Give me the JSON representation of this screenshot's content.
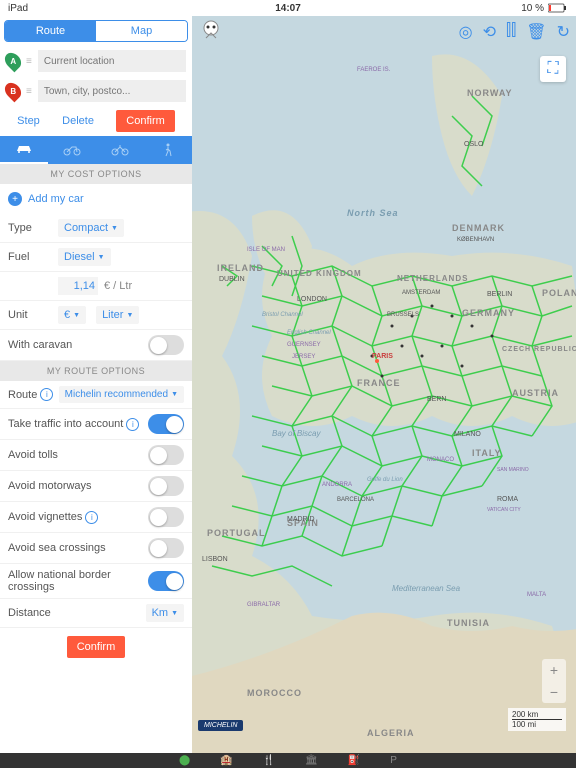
{
  "status": {
    "device": "iPad",
    "time": "14:07",
    "battery": "10 %"
  },
  "tabs": {
    "route": "Route",
    "map": "Map"
  },
  "waypoints": {
    "a": {
      "letter": "A",
      "color": "#2e9e5b",
      "placeholder": "Current location"
    },
    "b": {
      "letter": "B",
      "color": "#d9321f",
      "placeholder": "Town, city, postco..."
    }
  },
  "actions": {
    "step": "Step",
    "delete": "Delete",
    "confirm": "Confirm"
  },
  "sections": {
    "cost": "MY COST OPTIONS",
    "route": "MY ROUTE OPTIONS"
  },
  "addCar": "Add my car",
  "cost": {
    "typeLabel": "Type",
    "typeValue": "Compact",
    "fuelLabel": "Fuel",
    "fuelValue": "Diesel",
    "priceValue": "1,14",
    "priceUnit": "€ / Ltr",
    "unitLabel": "Unit",
    "currency": "€",
    "volume": "Liter",
    "caravanLabel": "With caravan"
  },
  "route": {
    "routeLabel": "Route",
    "routeValue": "Michelin recommended",
    "traffic": "Take traffic into account",
    "tolls": "Avoid tolls",
    "motorways": "Avoid motorways",
    "vignettes": "Avoid vignettes",
    "sea": "Avoid sea crossings",
    "border": "Allow national border crossings",
    "distanceLabel": "Distance",
    "distanceValue": "Km"
  },
  "confirmBtn": "Confirm",
  "mapLabels": {
    "norway": "NORWAY",
    "denmark": "DENMARK",
    "ireland": "IRELAND",
    "uk": "UNITED KINGDOM",
    "netherlands": "NETHERLANDS",
    "germany": "GERMANY",
    "poland": "POLAND",
    "czech": "CZECH REPUBLIC",
    "austria": "AUSTRIA",
    "france": "FRANCE",
    "spain": "SPAIN",
    "portugal": "PORTUGAL",
    "italy": "ITALY",
    "tunisia": "TUNISIA",
    "morocco": "MOROCCO",
    "algeria": "ALGERIA",
    "northsea": "North Sea",
    "mediterranean": "Mediterranean Sea",
    "biscay": "Bay of Biscay",
    "paris": "PARIS",
    "london": "LONDON",
    "madrid": "MADRID",
    "lisbon": "LISBON",
    "dublin": "DUBLIN",
    "berlin": "BERLIN",
    "amsterdam": "AMSTERDAM",
    "brussels": "BRUSSELS",
    "bern": "BERN",
    "oslo": "OSLO",
    "copenhagen": "KØBENHAVN",
    "milano": "MILANO",
    "barcelona": "BARCELONA",
    "roma": "ROMA",
    "vaticancity": "VATICAN CITY",
    "guernsey": "GUERNSEY",
    "jersey": "JERSEY",
    "andorra": "ANDORRA",
    "gibraltar": "GIBRALTAR",
    "malta": "MALTA",
    "sanmarino": "SAN MARINO",
    "monaco": "MONACO",
    "bristol": "Bristol Channel",
    "english": "English Channel",
    "golfe": "Golfe du Lion",
    "isleofman": "ISLE OF MAN",
    "faeroe": "FAEROE IS."
  },
  "scale": {
    "km": "200 km",
    "mi": "100 mi"
  },
  "logo": "MICHELIN"
}
